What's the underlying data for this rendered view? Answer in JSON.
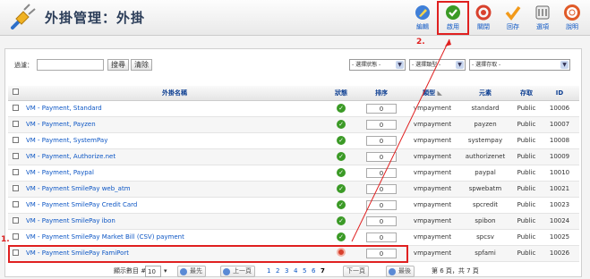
{
  "header": {
    "title": "外掛管理：外掛"
  },
  "toolbar": [
    {
      "label": "編輯",
      "icon": "edit-icon"
    },
    {
      "label": "啟用",
      "icon": "enable-check-icon"
    },
    {
      "label": "關閉",
      "icon": "disable-icon"
    },
    {
      "label": "回存",
      "icon": "checkin-icon"
    },
    {
      "label": "選項",
      "icon": "options-icon"
    },
    {
      "label": "說明",
      "icon": "help-icon"
    }
  ],
  "filter": {
    "label": "過濾：",
    "value": "",
    "search_label": "搜尋",
    "clear_label": "清除",
    "status_select": "- 選擇狀態 -",
    "type_select": "- 選擇類型 -",
    "access_select": "- 選擇存取 -"
  },
  "columns": {
    "name": "外掛名稱",
    "status": "狀態",
    "order": "排序",
    "type": "類型",
    "element": "元素",
    "access": "存取",
    "id": "ID"
  },
  "rows": [
    {
      "name": "VM - Payment, Standard",
      "status": "on",
      "order": "0",
      "type": "vmpayment",
      "element": "standard",
      "access": "Public",
      "id": "10006"
    },
    {
      "name": "VM - Payment, Payzen",
      "status": "on",
      "order": "0",
      "type": "vmpayment",
      "element": "payzen",
      "access": "Public",
      "id": "10007"
    },
    {
      "name": "VM - Payment, SystemPay",
      "status": "on",
      "order": "0",
      "type": "vmpayment",
      "element": "systempay",
      "access": "Public",
      "id": "10008"
    },
    {
      "name": "VM - Payment, Authorize.net",
      "status": "on",
      "order": "0",
      "type": "vmpayment",
      "element": "authorizenet",
      "access": "Public",
      "id": "10009"
    },
    {
      "name": "VM - Payment, Paypal",
      "status": "on",
      "order": "0",
      "type": "vmpayment",
      "element": "paypal",
      "access": "Public",
      "id": "10010"
    },
    {
      "name": "VM - Payment SmilePay web_atm",
      "status": "on",
      "order": "0",
      "type": "vmpayment",
      "element": "spwebatm",
      "access": "Public",
      "id": "10021"
    },
    {
      "name": "VM - Payment SmilePay Credit Card",
      "status": "on",
      "order": "0",
      "type": "vmpayment",
      "element": "spcredit",
      "access": "Public",
      "id": "10023"
    },
    {
      "name": "VM - Payment SmilePay ibon",
      "status": "on",
      "order": "0",
      "type": "vmpayment",
      "element": "spibon",
      "access": "Public",
      "id": "10024"
    },
    {
      "name": "VM - Payment SmilePay Market Bill (CSV) payment",
      "status": "on",
      "order": "0",
      "type": "vmpayment",
      "element": "spcsv",
      "access": "Public",
      "id": "10025"
    },
    {
      "name": "VM - Payment SmilePay FamiPort",
      "status": "off",
      "order": "0",
      "type": "vmpayment",
      "element": "spfami",
      "access": "Public",
      "id": "10026"
    }
  ],
  "annotations": {
    "step1": "1.",
    "step2": "2."
  },
  "pagination": {
    "display_label": "顯示數目 #",
    "display_value": "10",
    "start": "最先",
    "prev": "上一頁",
    "pages": [
      "1",
      "2",
      "3",
      "4",
      "5",
      "6",
      "7"
    ],
    "current_page": "7",
    "next": "下一頁",
    "end": "最後",
    "page_info": "第 6 頁，共 7 頁"
  },
  "colors": {
    "accent_blue": "#0b55c4",
    "status_on": "#3b9a26",
    "status_off": "#d8412d",
    "annotation_red": "#e02020"
  }
}
